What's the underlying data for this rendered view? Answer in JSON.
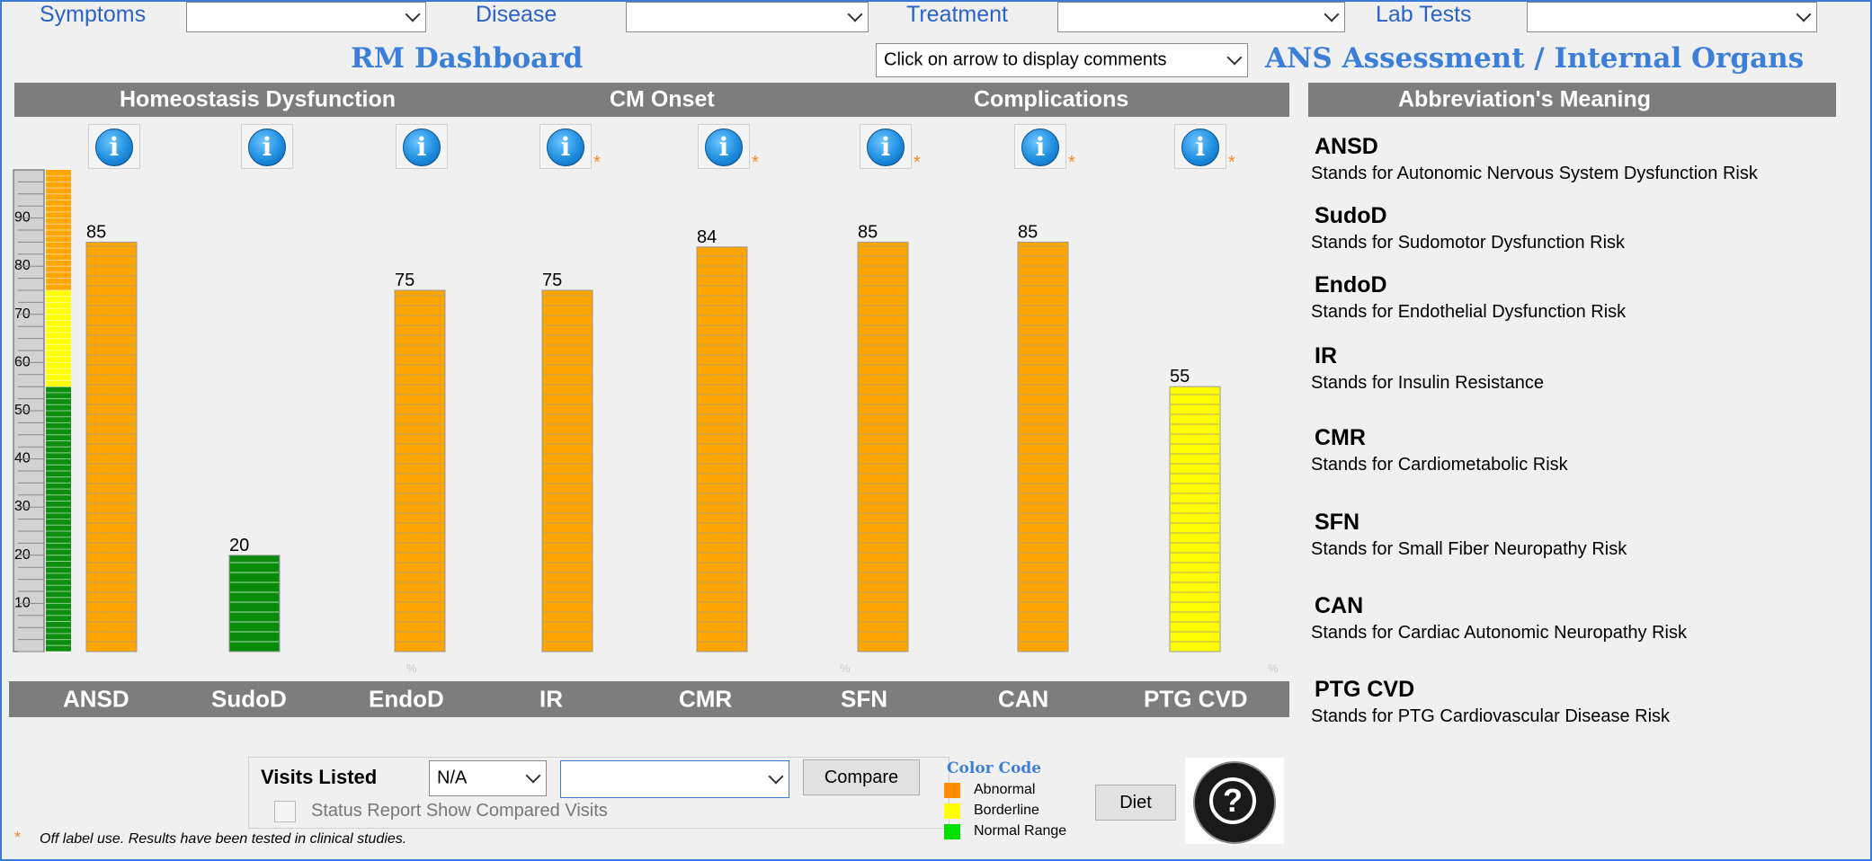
{
  "filters": {
    "symptoms_label": "Symptoms",
    "disease_label": "Disease",
    "treatment_label": "Treatment",
    "lab_tests_label": "Lab Tests"
  },
  "titles": {
    "dashboard": "RM Dashboard",
    "assessment": "ANS Assessment / Internal Organs"
  },
  "comments_select": {
    "value": "Click on arrow to display comments"
  },
  "section_headers": {
    "homeostasis": "Homeostasis Dysfunction",
    "cm_onset": "CM Onset",
    "complications": "Complications",
    "abbreviations": "Abbreviation's Meaning"
  },
  "info_icons": [
    {
      "starred": false
    },
    {
      "starred": false
    },
    {
      "starred": false
    },
    {
      "starred": true
    },
    {
      "starred": true
    },
    {
      "starred": true
    },
    {
      "starred": true
    },
    {
      "starred": true
    }
  ],
  "star_symbol": "*",
  "info_symbol": "i",
  "percent_symbol": "%",
  "scale": {
    "ticks": [
      "90",
      "80",
      "70",
      "60",
      "50",
      "40",
      "30",
      "20",
      "10"
    ],
    "zones": [
      {
        "from": 0,
        "to": 55,
        "color": "#0c8f0c"
      },
      {
        "from": 55,
        "to": 75,
        "color": "#ffff00"
      },
      {
        "from": 75,
        "to": 100,
        "color": "#ffa500"
      }
    ]
  },
  "chart_data": {
    "type": "bar",
    "categories": [
      "ANSD",
      "SudoD",
      "EndoD",
      "IR",
      "CMR",
      "SFN",
      "CAN",
      "PTG CVD"
    ],
    "values": [
      85,
      20,
      75,
      75,
      84,
      85,
      85,
      55
    ],
    "bar_colors": [
      "#ffa500",
      "#0a8a0a",
      "#ffa500",
      "#ffa500",
      "#ffa500",
      "#ffa500",
      "#ffa500",
      "#ffff00"
    ],
    "ylim": [
      0,
      100
    ],
    "grid": false,
    "legend": "bottom"
  },
  "abbreviations": [
    {
      "key": "ANSD",
      "desc": "Stands for Autonomic Nervous System Dysfunction Risk"
    },
    {
      "key": "SudoD",
      "desc": "Stands for Sudomotor Dysfunction Risk"
    },
    {
      "key": "EndoD",
      "desc": "Stands for Endothelial Dysfunction Risk"
    },
    {
      "key": "IR",
      "desc": "Stands for Insulin Resistance"
    },
    {
      "key": "CMR",
      "desc": "Stands for Cardiometabolic Risk"
    },
    {
      "key": "SFN",
      "desc": "Stands for Small Fiber Neuropathy Risk"
    },
    {
      "key": "CAN",
      "desc": "Stands for Cardiac Autonomic Neuropathy Risk"
    },
    {
      "key": "PTG CVD",
      "desc": "Stands for PTG Cardiovascular Disease Risk"
    }
  ],
  "visits": {
    "label": "Visits Listed",
    "select_value": "N/A",
    "compare_button": "Compare",
    "checkbox_label": "Status Report Show Compared Visits"
  },
  "color_code": {
    "title": "Color Code",
    "items": [
      {
        "label": "Abnormal",
        "color": "#ff8c00"
      },
      {
        "label": "Borderline",
        "color": "#ffff00"
      },
      {
        "label": "Normal Range",
        "color": "#00e000"
      }
    ]
  },
  "diet_button": "Diet",
  "help_symbol": "?",
  "footnote": "Off label use. Results have been tested in clinical studies."
}
